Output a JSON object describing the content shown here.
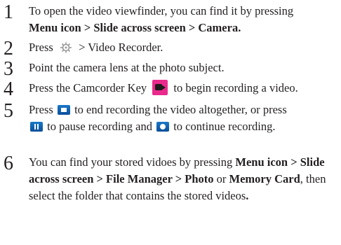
{
  "steps": [
    {
      "num": "1",
      "text": "To open the video viewfinder, you can find it by pressing",
      "bold": "Menu icon > Slide across screen > Camera."
    },
    {
      "num": "2",
      "pre": "Press",
      "icon": "settings-gear-icon",
      "post": "> Video Recorder."
    },
    {
      "num": "3",
      "text": "Point the camera lens at the photo subject."
    },
    {
      "num": "4",
      "pre": "Press the Camcorder Key",
      "icon": "camcorder-key-icon",
      "post": "to begin recording a video."
    },
    {
      "num": "5",
      "pre": "Press",
      "icon1": "stop-button-icon",
      "mid1": "to end recording the video altogether, or press",
      "icon2": "pause-button-icon",
      "mid2": "to pause recording and",
      "icon3": "record-button-icon",
      "post": "to continue recording."
    },
    {
      "num": "6",
      "pre": "You can find your stored vidoes by pressing",
      "bold1": "Menu icon > Slide across screen > File Manager > Photo",
      "or": "or",
      "bold2": "Memory Card",
      "post": ", then select the folder that contains the stored videos",
      "end": "."
    }
  ]
}
